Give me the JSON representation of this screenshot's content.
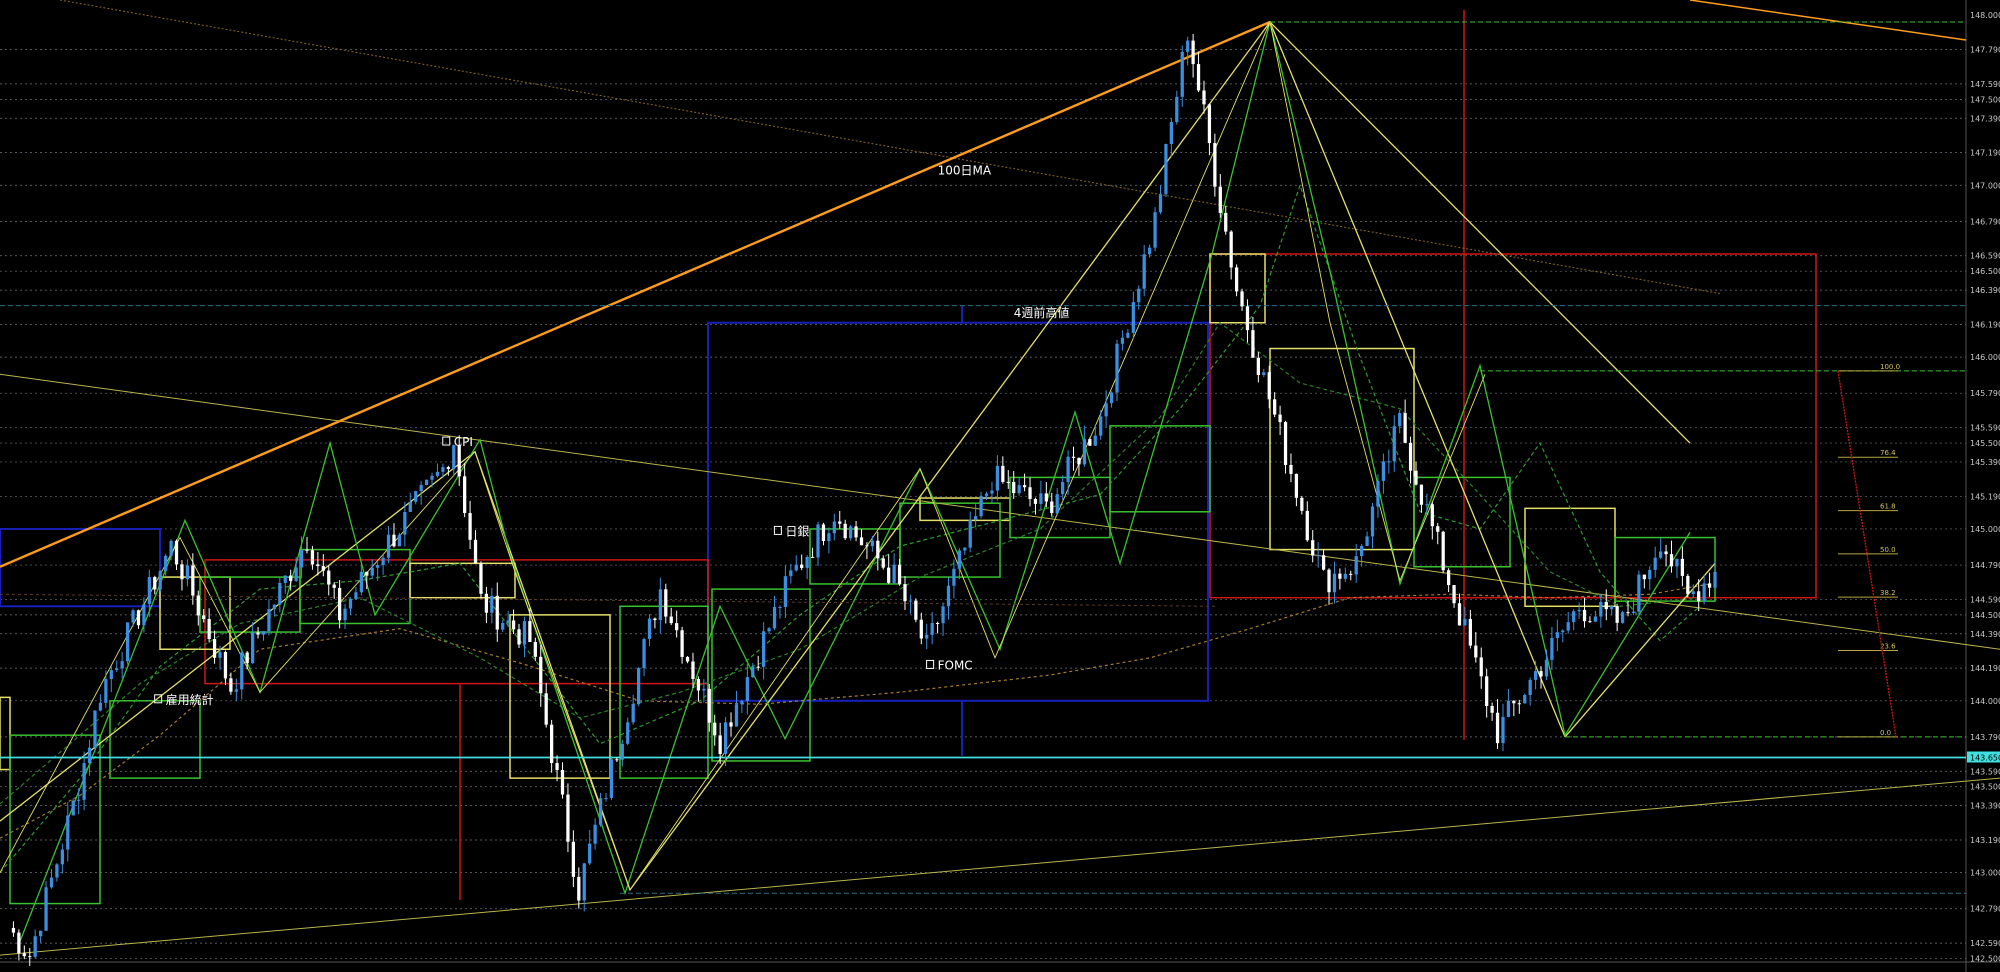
{
  "chart_data": {
    "type": "candlestick",
    "ylim": [
      142.48,
      148.02
    ],
    "grid": true,
    "price_levels": [
      {
        "price": 147.79,
        "label": "147.790",
        "style": "dotted",
        "color": "#6f7680"
      },
      {
        "price": 147.59,
        "label": "147.590",
        "style": "dotted",
        "color": "#6f7680"
      },
      {
        "price": 147.5,
        "label": "147.500",
        "style": "dotted",
        "color": "#6f7680"
      },
      {
        "price": 147.39,
        "label": "147.390",
        "style": "dotted",
        "color": "#6f7680"
      },
      {
        "price": 147.19,
        "label": "147.190",
        "style": "dotted",
        "color": "#6f7680"
      },
      {
        "price": 147.0,
        "label": "147.000",
        "style": "dotted",
        "color": "#6f7680"
      },
      {
        "price": 146.79,
        "label": "146.790",
        "style": "dotted",
        "color": "#6f7680"
      },
      {
        "price": 146.59,
        "label": "146.590",
        "style": "dotted",
        "color": "#6f7680"
      },
      {
        "price": 146.5,
        "label": "146.500",
        "style": "dotted",
        "color": "#6f7680"
      },
      {
        "price": 146.39,
        "label": "146.390",
        "style": "dotted",
        "color": "#6f7680"
      },
      {
        "price": 146.19,
        "label": "146.190",
        "style": "dotted",
        "color": "#6f7680"
      },
      {
        "price": 146.0,
        "label": "146.000",
        "style": "dotted",
        "color": "#6f7680"
      },
      {
        "price": 145.79,
        "label": "145.790",
        "style": "dotted",
        "color": "#6f7680"
      },
      {
        "price": 145.59,
        "label": "145.590",
        "style": "dotted",
        "color": "#6f7680"
      },
      {
        "price": 145.5,
        "label": "145.500",
        "style": "dotted",
        "color": "#6f7680"
      },
      {
        "price": 145.39,
        "label": "145.390",
        "style": "dotted",
        "color": "#6f7680"
      },
      {
        "price": 145.19,
        "label": "145.190",
        "style": "dotted",
        "color": "#6f7680"
      },
      {
        "price": 145.0,
        "label": "145.000",
        "style": "dotted",
        "color": "#6f7680"
      },
      {
        "price": 144.79,
        "label": "144.790",
        "style": "dotted",
        "color": "#6f7680"
      },
      {
        "price": 144.59,
        "label": "144.590",
        "style": "dotted",
        "color": "#6f7680"
      },
      {
        "price": 144.5,
        "label": "144.500",
        "style": "dotted",
        "color": "#6f7680"
      },
      {
        "price": 144.39,
        "label": "144.390",
        "style": "dotted",
        "color": "#6f7680"
      },
      {
        "price": 144.19,
        "label": "144.190",
        "style": "dotted",
        "color": "#6f7680"
      },
      {
        "price": 144.0,
        "label": "144.000",
        "style": "dotted",
        "color": "#6f7680"
      },
      {
        "price": 143.79,
        "label": "143.790",
        "style": "dotted",
        "color": "#6f7680"
      },
      {
        "price": 143.59,
        "label": "143.590",
        "style": "dotted",
        "color": "#6f7680"
      },
      {
        "price": 143.5,
        "label": "143.500",
        "style": "dotted",
        "color": "#6f7680"
      },
      {
        "price": 143.39,
        "label": "143.390",
        "style": "dotted",
        "color": "#6f7680"
      },
      {
        "price": 143.19,
        "label": "143.190",
        "style": "dotted",
        "color": "#6f7680"
      },
      {
        "price": 143.0,
        "label": "143.000",
        "style": "dotted",
        "color": "#6f7680"
      },
      {
        "price": 142.79,
        "label": "142.790",
        "style": "dotted",
        "color": "#6f7680"
      },
      {
        "price": 142.59,
        "label": "142.590",
        "style": "dotted",
        "color": "#6f7680"
      },
      {
        "price": 142.5,
        "label": "142.500",
        "style": "dotted",
        "color": "#6f7680"
      }
    ],
    "current_price": {
      "price": 143.67,
      "label": "143.650",
      "color": "#40e0e0"
    },
    "top_price_label": "148.000",
    "annotations": [
      {
        "text": "100日MA",
        "price": 147.08,
        "bar": 171
      },
      {
        "text": "4週前高値",
        "price": 146.25,
        "bar": 185
      },
      {
        "text": "CPI",
        "price": 145.5,
        "bar": 82
      },
      {
        "text": "日銀",
        "price": 144.98,
        "bar": 143
      },
      {
        "text": "FOMC",
        "price": 144.2,
        "bar": 171
      },
      {
        "text": "雇用統計",
        "price": 144.0,
        "bar": 29
      }
    ],
    "fib_labels": [
      "100.0",
      "76.4",
      "61.8",
      "50.0",
      "38.2",
      "23.6",
      "0.0"
    ],
    "fib_range": {
      "high": 145.92,
      "low": 143.79
    },
    "colors": {
      "bull": "#3a8fe0",
      "bear": "#ffffff",
      "ma100": "#ff9c1a",
      "zigzag_green": "#39c22f",
      "zigzag_yellow": "#e5e069",
      "box_red": "#d01515",
      "box_blue": "#1720b8",
      "current": "#40e0e0"
    },
    "candles": {
      "count": 336,
      "pivots": [
        [
          0,
          142.68
        ],
        [
          4,
          142.52
        ],
        [
          13,
          143.5
        ],
        [
          17,
          144.05
        ],
        [
          30,
          144.9
        ],
        [
          33,
          144.7
        ],
        [
          41,
          144.08
        ],
        [
          55,
          144.95
        ],
        [
          61,
          144.5
        ],
        [
          69,
          144.88
        ],
        [
          80,
          145.35
        ],
        [
          82,
          145.52
        ],
        [
          87,
          144.58
        ],
        [
          96,
          144.35
        ],
        [
          105,
          142.9
        ],
        [
          111,
          143.6
        ],
        [
          120,
          144.65
        ],
        [
          131,
          143.78
        ],
        [
          144,
          144.72
        ],
        [
          152,
          145.1
        ],
        [
          163,
          144.72
        ],
        [
          169,
          144.3
        ],
        [
          181,
          145.3
        ],
        [
          191,
          145.12
        ],
        [
          201,
          145.65
        ],
        [
          211,
          146.8
        ],
        [
          217,
          147.9
        ],
        [
          226,
          146.4
        ],
        [
          242,
          144.7
        ],
        [
          248,
          144.8
        ],
        [
          256,
          145.62
        ],
        [
          262,
          145.0
        ],
        [
          270,
          144.2
        ],
        [
          274,
          143.82
        ],
        [
          289,
          144.55
        ],
        [
          297,
          144.45
        ],
        [
          304,
          144.95
        ],
        [
          309,
          144.6
        ],
        [
          314,
          144.75
        ]
      ]
    }
  }
}
